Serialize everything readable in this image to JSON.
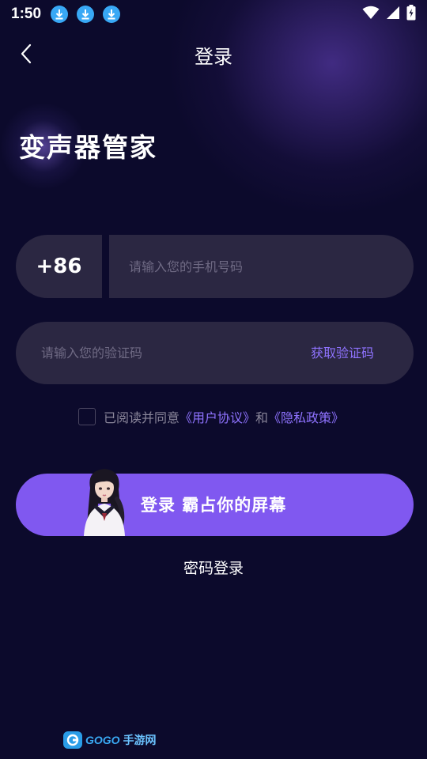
{
  "status_bar": {
    "time": "1:50",
    "notifications": [
      "download-icon",
      "download-icon",
      "download-icon"
    ],
    "indicators": [
      "wifi-icon",
      "signal-icon",
      "battery-charging-icon"
    ]
  },
  "header": {
    "back_icon": "chevron-left-icon",
    "title": "登录"
  },
  "app_name": "变声器管家",
  "phone": {
    "country_code": "+86",
    "placeholder": "请输入您的手机号码",
    "value": ""
  },
  "code": {
    "placeholder": "请输入您的验证码",
    "value": "",
    "get_code_label": "获取验证码"
  },
  "agreement": {
    "checked": false,
    "prefix": "已阅读并同意",
    "user_agreement": "《用户协议》",
    "and": "和",
    "privacy_policy": "《隐私政策》"
  },
  "login_button": {
    "label": "登录 霸占你的屏幕"
  },
  "password_login": "密码登录",
  "watermark": {
    "text": "GOGO",
    "suffix": "手游网"
  },
  "colors": {
    "background": "#0c0a2c",
    "field": "#2b2742",
    "accent": "#8058f0",
    "link": "#8f73ff",
    "download_badge": "#38a8f5"
  }
}
